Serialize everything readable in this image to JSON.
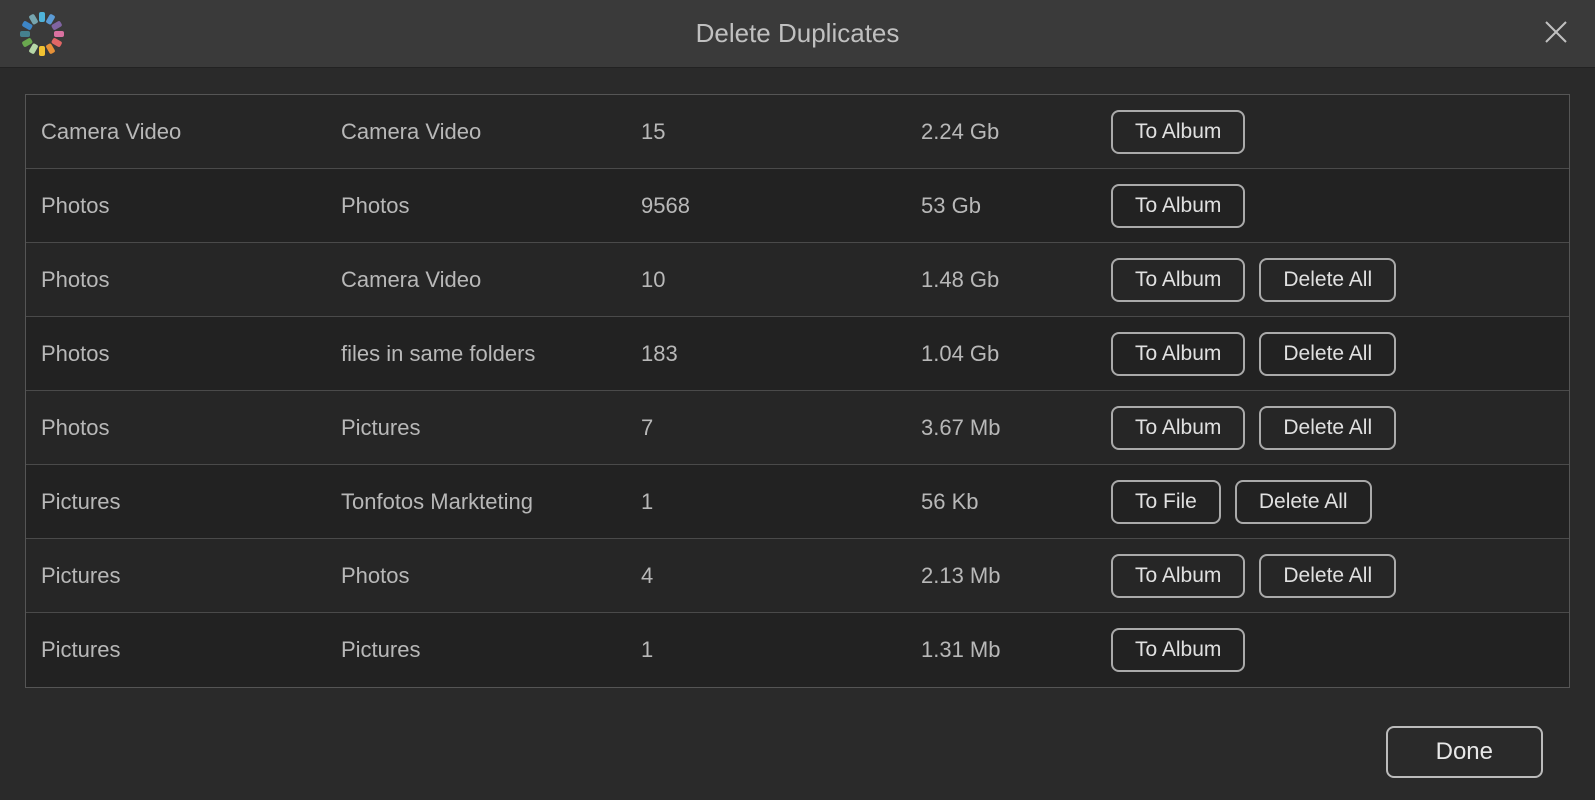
{
  "header": {
    "title": "Delete Duplicates"
  },
  "rows": [
    {
      "col1": "Camera Video",
      "col2": "Camera Video",
      "count": "15",
      "size": "2.24 Gb",
      "primary": "To Album",
      "secondary": null
    },
    {
      "col1": "Photos",
      "col2": "Photos",
      "count": "9568",
      "size": "53 Gb",
      "primary": "To Album",
      "secondary": null
    },
    {
      "col1": "Photos",
      "col2": "Camera Video",
      "count": "10",
      "size": "1.48 Gb",
      "primary": "To Album",
      "secondary": "Delete All"
    },
    {
      "col1": "Photos",
      "col2": "files in same folders",
      "count": "183",
      "size": "1.04 Gb",
      "primary": "To Album",
      "secondary": "Delete All"
    },
    {
      "col1": "Photos",
      "col2": "Pictures",
      "count": "7",
      "size": "3.67 Mb",
      "primary": "To Album",
      "secondary": "Delete All"
    },
    {
      "col1": "Pictures",
      "col2": "Tonfotos Markteting",
      "count": "1",
      "size": "56 Kb",
      "primary": "To File",
      "secondary": "Delete All"
    },
    {
      "col1": "Pictures",
      "col2": "Photos",
      "count": "4",
      "size": "2.13 Mb",
      "primary": "To Album",
      "secondary": "Delete All"
    },
    {
      "col1": "Pictures",
      "col2": "Pictures",
      "count": "1",
      "size": "1.31 Mb",
      "primary": "To Album",
      "secondary": null
    }
  ],
  "footer": {
    "done_label": "Done"
  }
}
